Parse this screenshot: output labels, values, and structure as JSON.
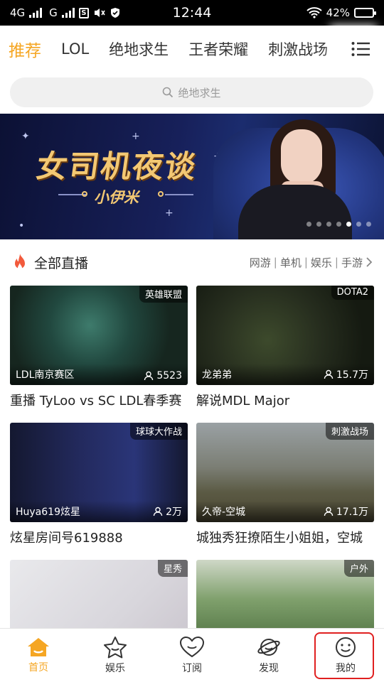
{
  "status_bar": {
    "net1": "4G",
    "net2": "G",
    "time": "12:44",
    "battery": "42%"
  },
  "top_tabs": [
    {
      "label": "推荐",
      "active": true
    },
    {
      "label": "LOL",
      "active": false
    },
    {
      "label": "绝地求生",
      "active": false
    },
    {
      "label": "王者荣耀",
      "active": false
    },
    {
      "label": "刺激战场",
      "active": false
    }
  ],
  "search": {
    "placeholder": "绝地求生"
  },
  "banner": {
    "title": "女司机夜谈",
    "subtitle": "小伊米",
    "dot_count": 7,
    "active_dot": 5
  },
  "section": {
    "title": "全部直播",
    "filters": [
      "网游",
      "单机",
      "娱乐",
      "手游"
    ]
  },
  "cards": [
    {
      "tag": "英雄联盟",
      "streamer": "LDL南京赛区",
      "viewers": "5523",
      "title": "重播 TyLoo vs SC LDL春季赛"
    },
    {
      "tag": "DOTA2",
      "streamer": "龙弟弟",
      "viewers": "15.7万",
      "title": "解说MDL Major"
    },
    {
      "tag": "球球大作战",
      "streamer": "Huya619炫星",
      "viewers": "2万",
      "title": "炫星房间号619888"
    },
    {
      "tag": "刺激战场",
      "streamer": "久帝-空城",
      "viewers": "17.1万",
      "title": "城独秀狂撩陌生小姐姐，空城"
    },
    {
      "tag": "星秀",
      "streamer": "",
      "viewers": "",
      "title": ""
    },
    {
      "tag": "户外",
      "streamer": "",
      "viewers": "",
      "title": ""
    }
  ],
  "bottom_nav": [
    {
      "label": "首页",
      "icon": "home-icon",
      "active": true
    },
    {
      "label": "娱乐",
      "icon": "star-icon",
      "active": false
    },
    {
      "label": "订阅",
      "icon": "heart-icon",
      "active": false
    },
    {
      "label": "发现",
      "icon": "planet-icon",
      "active": false
    },
    {
      "label": "我的",
      "icon": "profile-face-icon",
      "active": false
    }
  ],
  "colors": {
    "accent": "#f5a623",
    "highlight": "#e02020"
  }
}
